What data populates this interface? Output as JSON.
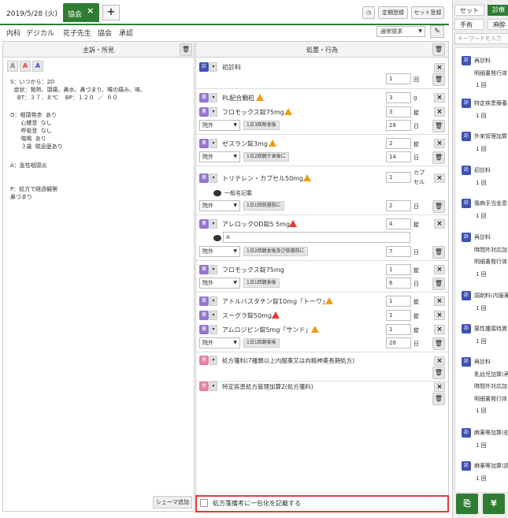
{
  "header": {
    "date": "2019/5/28 (火)",
    "tab_label": "協会",
    "close": "×",
    "add": "+",
    "history_icon": "clock-icon",
    "btn_period": "定期登録",
    "btn_set": "セット登録"
  },
  "dept": [
    "内科",
    "デジカル",
    "花子先生",
    "協会",
    "承認"
  ],
  "claim_select": "通常請求",
  "left": {
    "title": "主訴・所見",
    "fmt_buttons": [
      "A",
      "A",
      "A"
    ],
    "notes": [
      "S：いつから：2D\n  症状：発熱、頭痛、鼻水、鼻づまり、喉の痛み、咳、\n    BT：３７．８℃    BP：１２０  ／  ６０",
      "O：咽頭発赤  あり\n      心雑音  なし\n      呼吸音  なし\n      喘鳴  あり\n      ３歳  喘息歴あり",
      "A：急性咽頭炎",
      "P：処方で経過観察\n鼻づまり"
    ],
    "schema_btn": "シェーマ追加"
  },
  "right": {
    "title": "処置・行為",
    "badges": {
      "shin": "診",
      "yaku": "薬",
      "hou": "他"
    },
    "groups": [
      {
        "items": [
          {
            "name": "初診料",
            "qty": "1",
            "unit": "回"
          }
        ]
      },
      {
        "items": [
          {
            "name": "PL配合顆粒",
            "qty": "3",
            "unit": "g",
            "warn": "orange"
          },
          {
            "name": "フロモックス錠75mg",
            "qty": "3",
            "unit": "錠",
            "warn": "orange"
          }
        ],
        "route": "院外",
        "timing": "1日3回毎食後",
        "days": "28",
        "days_unit": "日"
      },
      {
        "items": [
          {
            "name": "ゼスラン錠3mg",
            "qty": "2",
            "unit": "錠",
            "warn": "orange"
          }
        ],
        "route": "院外",
        "timing": "1日2回朝夕食後に",
        "days": "14",
        "days_unit": "日"
      },
      {
        "items": [
          {
            "name": "トリテレン・カプセル50mg",
            "qty": "1",
            "unit": "カプセル",
            "warn": "orange"
          }
        ],
        "comment": "一般名記載",
        "route": "院外",
        "timing": "1日1回就寝前に",
        "days": "2",
        "days_unit": "日"
      },
      {
        "items": [
          {
            "name": "アレロックOD錠5 5mg",
            "qty": "4",
            "unit": "錠",
            "warn": "red"
          }
        ],
        "comment_input": "A",
        "route": "院外",
        "timing": "1日2回朝食後及び就寝前に",
        "days": "7",
        "days_unit": "日"
      },
      {
        "items": [
          {
            "name": "フロモックス錠75mg",
            "qty": "1",
            "unit": "錠"
          }
        ],
        "route": "院外",
        "timing": "1日1回朝食後",
        "days": "6",
        "days_unit": "日"
      },
      {
        "items": [
          {
            "name": "アトルバスタチン錠10mg「トーワ」",
            "qty": "1",
            "unit": "錠",
            "warn": "orange"
          },
          {
            "name": "スーグラ錠50mg",
            "qty": "1",
            "unit": "錠",
            "warn": "red"
          },
          {
            "name": "アムロジピン錠5mg「サンド」",
            "qty": "1",
            "unit": "錠",
            "warn": "orange"
          }
        ],
        "route": "院外",
        "timing": "1日1回朝食後",
        "days": "28",
        "days_unit": "日"
      },
      {
        "items": [
          {
            "name": "処方箋料(7種類以上内服薬又は向精神薬長期処方)"
          }
        ]
      },
      {
        "items": [
          {
            "name": "特定疾患処方管理加算2(処方箋料)"
          }
        ]
      }
    ],
    "footer_check": "処方箋備考に一包化を記載する"
  },
  "sidebar": {
    "tabs": [
      "セット",
      "診療",
      "手術",
      "麻酔"
    ],
    "keyword_placeholder": "キーワードを入力",
    "items": [
      {
        "name": "再診料",
        "extra": "明細書発行体",
        "count": "1 回"
      },
      {
        "name": "特定疾患療養",
        "count": "1 回"
      },
      {
        "name": "外来管理加算",
        "count": "1 回"
      },
      {
        "name": "初診料",
        "count": "1 回"
      },
      {
        "name": "傷病手当金意",
        "count": "1 回"
      },
      {
        "name": "再診料",
        "extra": "時間外対応加",
        "extra2": "明細書発行体",
        "count": "1 回"
      },
      {
        "name": "調剤料(内服薬",
        "count": "1 回"
      },
      {
        "name": "悪性腫瘍特異",
        "count": "1 回"
      },
      {
        "name": "再診料",
        "extra": "乳幼児加算(再",
        "extra2": "時間外対応加",
        "extra3": "明細書発行体",
        "count": "1 回"
      },
      {
        "name": "麻薬等加算(処",
        "count": "1 回"
      },
      {
        "name": "麻薬等加算(調",
        "count": "1 回"
      }
    ],
    "shin_badge": "診",
    "colors": {
      "green": "#2e7d32",
      "badge_blue": "#3f51b5",
      "badge_purple": "#9575cd",
      "badge_pink": "#e57fa8",
      "warn_orange": "#f39c12",
      "warn_red": "#e53935"
    }
  }
}
